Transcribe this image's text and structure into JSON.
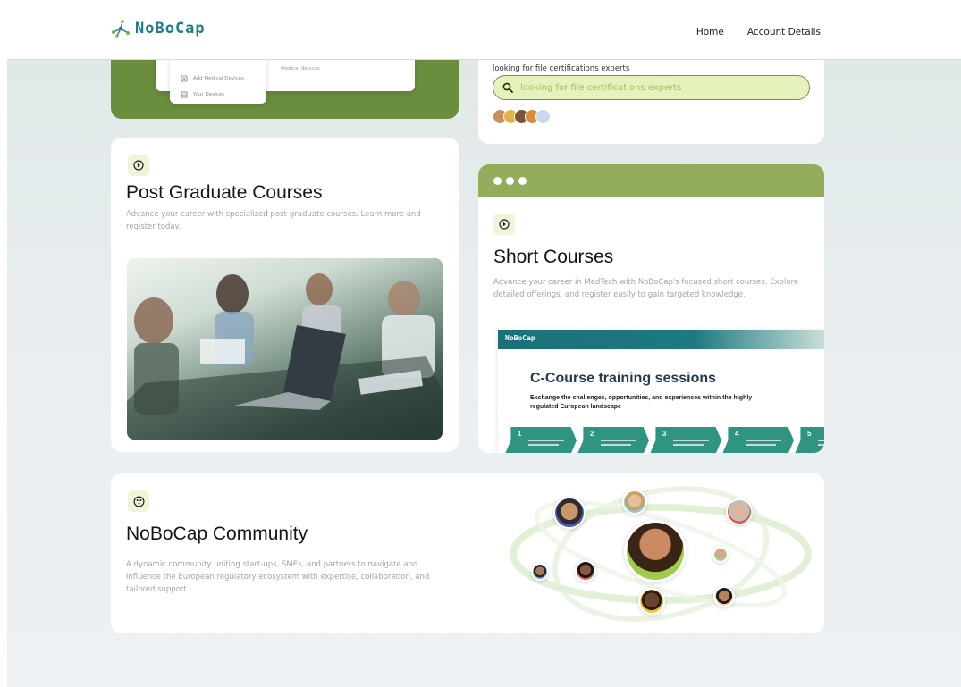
{
  "header": {
    "logo_text": "NoBoCap",
    "nav": [
      "Home",
      "Account Details"
    ]
  },
  "devices_card": {
    "items": [
      "Add Medical Devices",
      "Your Devices"
    ],
    "panel_text": "Medical devices"
  },
  "search_card": {
    "label": "looking for file certifications experts",
    "placeholder": "looking for file certifications experts",
    "avatar_colors": [
      "#c98f5a",
      "#e3b34b",
      "#7b5336",
      "#d98a3c",
      "#c7d8f0"
    ]
  },
  "post_graduate": {
    "icon": "play-circle-icon",
    "title": "Post Graduate Courses",
    "description": "Advance your career with specialized post-graduate courses. Learn more and register today."
  },
  "short_courses": {
    "icon": "play-circle-icon",
    "title": "Short Courses",
    "description": "Advance your career in MedTech with NoBoCap's focused short courses. Explore detailed offerings, and register easily to gain targeted knowledge.",
    "slide": {
      "logo": "NoBoCap",
      "title": "C-Course training sessions",
      "subtitle": "Exchange the challenges, opportunities, and experiences within the highly regulated European landscape",
      "steps": [
        "1",
        "2",
        "3",
        "4",
        "5"
      ]
    }
  },
  "community": {
    "icon": "community-icon",
    "title": "NoBoCap Community",
    "description": "A dynamic community uniting start-ups, SMEs, and partners to navigate and influence the European regulatory ecosystem with expertise, collaboration, and tailored support."
  },
  "colors": {
    "brand_teal": "#1f7c86",
    "brand_green": "#6a8e3e",
    "accent_light_green": "#e6f2bb",
    "bar_green": "#93ad5c"
  }
}
